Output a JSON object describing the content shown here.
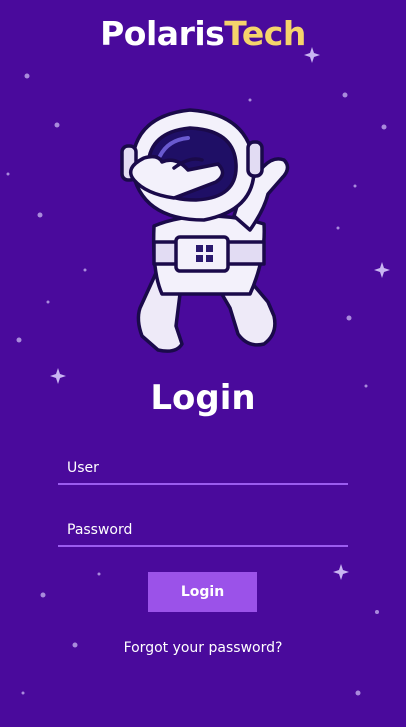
{
  "brand": {
    "part1": "Polaris",
    "part2": "Tech"
  },
  "login": {
    "title": "Login",
    "user_placeholder": "User",
    "password_placeholder": "Password",
    "submit_label": "Login",
    "forgot_link": "Forgot your password?"
  },
  "colors": {
    "background": "#4a0a9c",
    "accent": "#9b52e9",
    "brand_highlight": "#f5d46b"
  },
  "icons": {
    "illustration": "astronaut-dab-illustration",
    "decor": "sparkle-star-icon"
  }
}
